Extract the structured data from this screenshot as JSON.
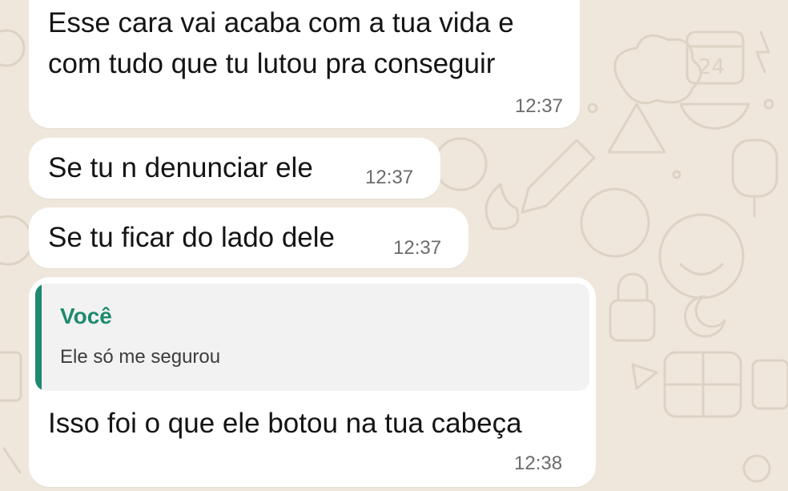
{
  "chat": {
    "background_color": "#efe7dc",
    "bubble_color": "#ffffff",
    "quote_accent_color": "#1f8a6f",
    "messages": [
      {
        "lines": [
          "Esse cara vai acaba com a tua vida e",
          "com tudo que tu lutou pra conseguir"
        ],
        "time": "12:37"
      },
      {
        "lines": [
          "Se tu n denunciar ele"
        ],
        "time": "12:37"
      },
      {
        "lines": [
          "Se tu ficar do lado dele"
        ],
        "time": "12:37"
      },
      {
        "quote": {
          "author": "Você",
          "text": "Ele só me segurou"
        },
        "lines": [
          "Isso foi o que ele botou na tua cabeça"
        ],
        "time": "12:38"
      }
    ]
  }
}
